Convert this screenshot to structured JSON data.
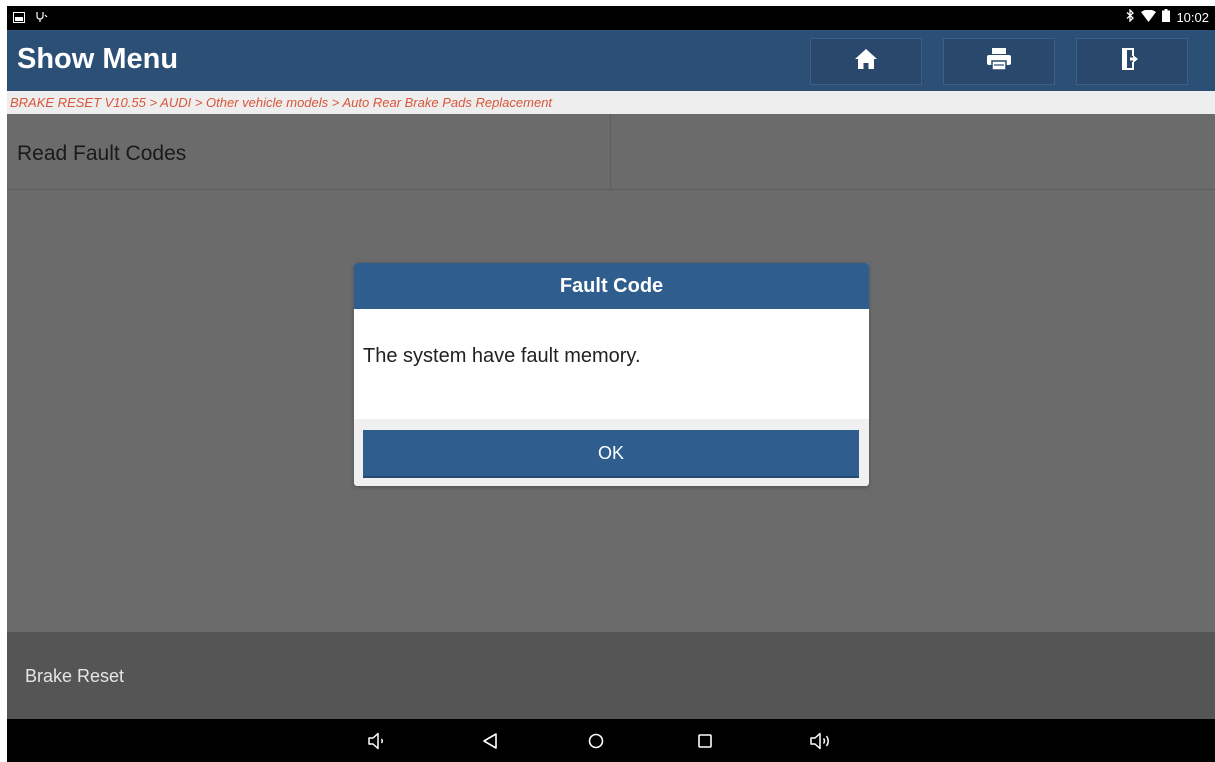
{
  "status_bar": {
    "time": "10:02",
    "icons": [
      "screenshot-icon",
      "usb-debug-icon",
      "bluetooth-icon",
      "wifi-icon",
      "battery-icon"
    ]
  },
  "header": {
    "title": "Show Menu",
    "buttons": [
      {
        "icon": "home-icon"
      },
      {
        "icon": "print-icon"
      },
      {
        "icon": "exit-icon"
      }
    ],
    "color": "#2c4f75"
  },
  "breadcrumb": {
    "text": "BRAKE RESET V10.55 > AUDI > Other vehicle models > Auto Rear Brake Pads Replacement",
    "color": "#d9563a"
  },
  "main": {
    "items": [
      {
        "label": "Read Fault Codes"
      }
    ]
  },
  "dialog": {
    "title": "Fault Code",
    "message": "The system have fault memory.",
    "ok_label": "OK",
    "color": "#2f5e8e"
  },
  "footer": {
    "label": "Brake Reset"
  },
  "nav_bar": {
    "icons": [
      "volume-down-icon",
      "back-icon",
      "home-circle-icon",
      "recent-apps-icon",
      "volume-up-icon"
    ]
  }
}
